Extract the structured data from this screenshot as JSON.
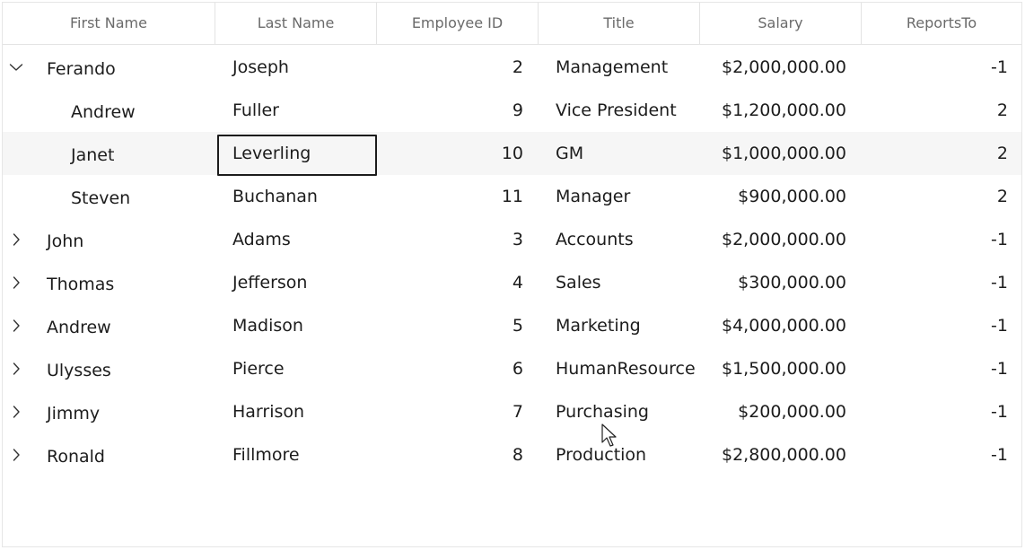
{
  "columns": {
    "first_name": "First Name",
    "last_name": "Last Name",
    "employee_id": "Employee ID",
    "title": "Title",
    "salary": "Salary",
    "reports_to": "ReportsTo"
  },
  "rows": [
    {
      "first": "Ferando",
      "last": "Joseph",
      "id": "2",
      "title": "Management",
      "salary": "$2,000,000.00",
      "reports": "-1",
      "expander": "chevron-down-icon"
    },
    {
      "first": "Andrew",
      "last": "Fuller",
      "id": "9",
      "title": "Vice President",
      "salary": "$1,200,000.00",
      "reports": "2",
      "expander": ""
    },
    {
      "first": "Janet",
      "last": "Leverling",
      "id": "10",
      "title": "GM",
      "salary": "$1,000,000.00",
      "reports": "2",
      "expander": ""
    },
    {
      "first": "Steven",
      "last": "Buchanan",
      "id": "11",
      "title": "Manager",
      "salary": "$900,000.00",
      "reports": "2",
      "expander": ""
    },
    {
      "first": "John",
      "last": "Adams",
      "id": "3",
      "title": "Accounts",
      "salary": "$2,000,000.00",
      "reports": "-1",
      "expander": "chevron-right-icon"
    },
    {
      "first": "Thomas",
      "last": "Jefferson",
      "id": "4",
      "title": "Sales",
      "salary": "$300,000.00",
      "reports": "-1",
      "expander": "chevron-right-icon"
    },
    {
      "first": "Andrew",
      "last": "Madison",
      "id": "5",
      "title": "Marketing",
      "salary": "$4,000,000.00",
      "reports": "-1",
      "expander": "chevron-right-icon"
    },
    {
      "first": "Ulysses",
      "last": "Pierce",
      "id": "6",
      "title": "HumanResource",
      "salary": "$1,500,000.00",
      "reports": "-1",
      "expander": "chevron-right-icon"
    },
    {
      "first": "Jimmy",
      "last": "Harrison",
      "id": "7",
      "title": "Purchasing",
      "salary": "$200,000.00",
      "reports": "-1",
      "expander": "chevron-right-icon"
    },
    {
      "first": "Ronald",
      "last": "Fillmore",
      "id": "8",
      "title": "Production",
      "salary": "$2,800,000.00",
      "reports": "-1",
      "expander": "chevron-right-icon"
    }
  ],
  "selected_row": 2,
  "focused_cell": "Leverling",
  "colors": {
    "header_text": "#6a6a6a",
    "border": "#e3e3e3",
    "selected_row": "#f6f6f6",
    "focus_border": "#1c1c1c"
  }
}
